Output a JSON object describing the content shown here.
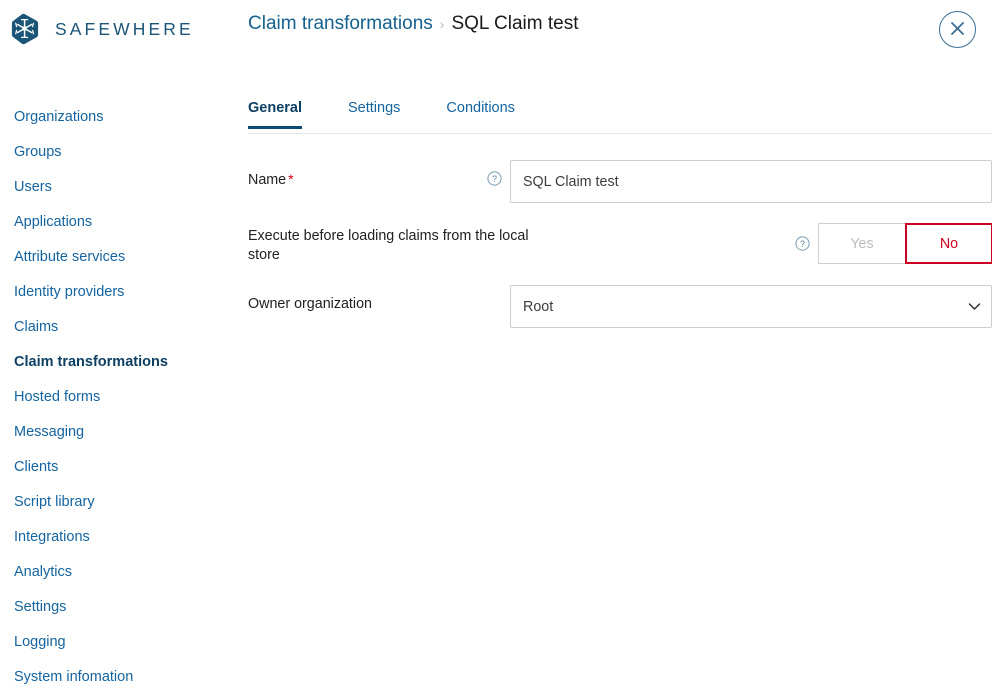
{
  "brand": {
    "name": "SAFEWHERE",
    "logo_icon": "hexagon-snowflake-icon",
    "logo_color": "#1b5578"
  },
  "header": {
    "breadcrumb": {
      "parent": "Claim transformations",
      "separator": "›",
      "current": "SQL Claim test"
    },
    "close_button": {
      "icon": "close-x-icon",
      "label": "Close",
      "color": "#3a6f94"
    }
  },
  "sidebar": {
    "items": [
      {
        "label": "Organizations",
        "active": false
      },
      {
        "label": "Groups",
        "active": false
      },
      {
        "label": "Users",
        "active": false
      },
      {
        "label": "Applications",
        "active": false
      },
      {
        "label": "Attribute services",
        "active": false
      },
      {
        "label": "Identity providers",
        "active": false
      },
      {
        "label": "Claims",
        "active": false
      },
      {
        "label": "Claim transformations",
        "active": true
      },
      {
        "label": "Hosted forms",
        "active": false
      },
      {
        "label": "Messaging",
        "active": false
      },
      {
        "label": "Clients",
        "active": false
      },
      {
        "label": "Script library",
        "active": false
      },
      {
        "label": "Integrations",
        "active": false
      },
      {
        "label": "Analytics",
        "active": false
      },
      {
        "label": "Settings",
        "active": false
      },
      {
        "label": "Logging",
        "active": false
      },
      {
        "label": "System infomation",
        "active": false
      }
    ]
  },
  "main": {
    "tabs": [
      {
        "label": "General",
        "active": true
      },
      {
        "label": "Settings",
        "active": false
      },
      {
        "label": "Conditions",
        "active": false
      }
    ],
    "form": {
      "name_field": {
        "label": "Name",
        "required_marker": "*",
        "help_icon": "help-circle-icon",
        "value": "SQL Claim test",
        "placeholder": "Name"
      },
      "execute_before_loading": {
        "label": "Execute before loading claims from the local store",
        "help_icon": "help-circle-icon",
        "options": [
          "Yes",
          "No"
        ],
        "yes_label": "Yes",
        "no_label": "No",
        "selected": "No"
      },
      "owner_organization": {
        "label": "Owner organization",
        "value": "Root",
        "options": [
          "Root"
        ],
        "chevron_icon": "chevron-down-icon"
      }
    }
  },
  "colors": {
    "link_blue": "#1464a0",
    "active_navy": "#0d3f63",
    "danger_red": "#cc0022",
    "required_red": "#d0021b",
    "border_gray": "#cdcdcd"
  }
}
